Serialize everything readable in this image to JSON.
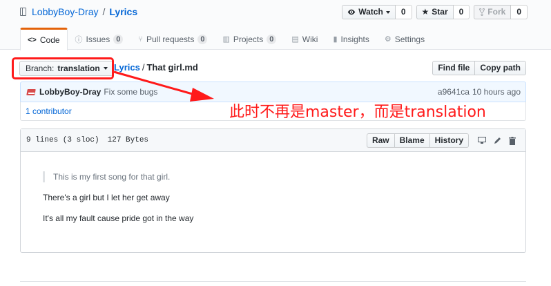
{
  "repo": {
    "owner": "LobbyBoy-Dray",
    "separator": "/",
    "name": "Lyrics",
    "actions": [
      {
        "label": "Watch",
        "count": "0",
        "icon": "eye-icon"
      },
      {
        "label": "Star",
        "count": "0",
        "icon": "star-icon"
      },
      {
        "label": "Fork",
        "count": "0",
        "icon": "fork-icon"
      }
    ]
  },
  "tabs": [
    {
      "label": "Code",
      "icon": "code-icon"
    },
    {
      "label": "Issues",
      "count": "0",
      "icon": "issue-icon"
    },
    {
      "label": "Pull requests",
      "count": "0",
      "icon": "pull-request-icon"
    },
    {
      "label": "Projects",
      "count": "0",
      "icon": "project-icon"
    },
    {
      "label": "Wiki",
      "icon": "book-icon"
    },
    {
      "label": "Insights",
      "icon": "graph-icon"
    },
    {
      "label": "Settings",
      "icon": "gear-icon"
    }
  ],
  "file_nav": {
    "branch_label": "Branch:",
    "branch_value": "translation",
    "breadcrumb_repo": "Lyrics",
    "breadcrumb_sep": "/",
    "breadcrumb_file": "That girl.md",
    "find_file": "Find file",
    "copy_path": "Copy path"
  },
  "commit": {
    "author": "LobbyBoy-Dray",
    "message": "Fix some bugs",
    "sha": "a9641ca",
    "time": "10 hours ago",
    "contributors": "1 contributor"
  },
  "annotation": {
    "text": "此时不再是master，而是translation",
    "color": "#ff1a1a"
  },
  "file": {
    "lines_info": "9 lines (3 sloc)",
    "size_info": "127 Bytes",
    "buttons": {
      "raw": "Raw",
      "blame": "Blame",
      "history": "History"
    },
    "icons": [
      "desktop-icon",
      "pencil-icon",
      "trash-icon"
    ],
    "content": {
      "blockquote": "This is my first song for that girl.",
      "line1": "There's a girl but I let her get away",
      "line2": "It's all my fault cause pride got in the way"
    }
  }
}
